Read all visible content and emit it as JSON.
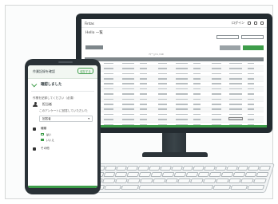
{
  "desktop": {
    "app_name": "Fintas",
    "page_title": "Hello 一覧",
    "top_status": "ログイン",
    "buttons": {
      "btn_a": "",
      "btn_b": "",
      "add": "",
      "csv": ""
    },
    "pager": "ページ 1 / 10",
    "columns": [
      "",
      "",
      "",
      "",
      "",
      "",
      "",
      "",
      "",
      ""
    ],
    "row_tags": [
      "pink",
      "pink",
      "pink",
      "grey",
      "grey",
      "red",
      "red",
      "red",
      "red",
      "red",
      "red",
      "red",
      "red",
      "red",
      "green"
    ]
  },
  "phone": {
    "header_title": "作業記録を確認",
    "header_button": "保存する",
    "subtitle": "確認しました",
    "notice_text": "作業を記録してください（必須）",
    "section_user": "担当者",
    "user_text": "このアンケートに回答していただいた",
    "user_field_value": "回答者",
    "section_select": "種類",
    "checkbox_options": [
      "はい",
      "いいえ"
    ],
    "section_other": "その他"
  },
  "colors": {
    "accent": "#3e9d4a",
    "frame_dark": "#232b30"
  }
}
